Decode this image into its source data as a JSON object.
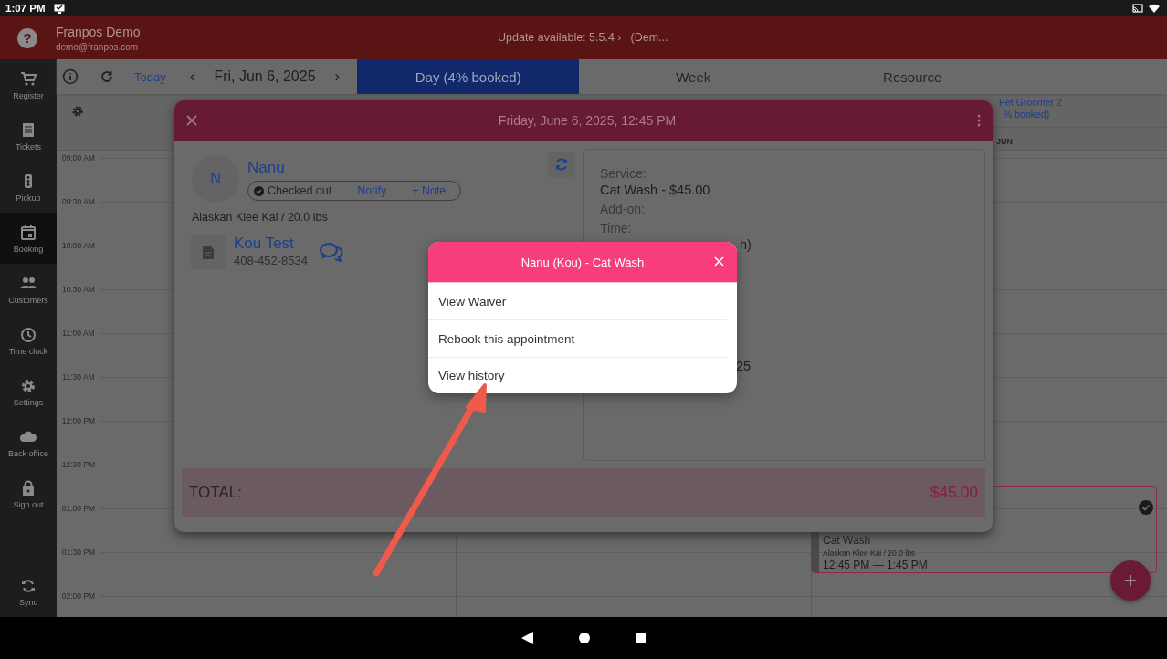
{
  "status_bar": {
    "time": "1:07 PM"
  },
  "header": {
    "help_icon": "?",
    "title": "Franpos Demo",
    "email": "demo@franpos.com",
    "update": "Update available: 5.5.4 ›",
    "update_note": "(Dem..."
  },
  "sidebar": {
    "items": [
      {
        "label": "Register",
        "selected": false
      },
      {
        "label": "Tickets",
        "selected": false
      },
      {
        "label": "Pickup",
        "selected": false
      },
      {
        "label": "Booking",
        "selected": true
      },
      {
        "label": "Customers",
        "selected": false
      },
      {
        "label": "Time clock",
        "selected": false
      },
      {
        "label": "Settings",
        "selected": false
      },
      {
        "label": "Back office",
        "selected": false
      },
      {
        "label": "Sign out",
        "selected": false
      }
    ],
    "sync": "Sync"
  },
  "toolbar": {
    "today": "Today",
    "prev": "‹",
    "date": "Fri, Jun 6, 2025",
    "next": "›",
    "tabs": [
      {
        "label": "Day (4% booked)",
        "selected": true
      },
      {
        "label": "Week",
        "selected": false
      },
      {
        "label": "Resource",
        "selected": false
      }
    ]
  },
  "calendar": {
    "resource": {
      "name": "Pet Groomer 2",
      "booked": "% booked)",
      "day": "JUN"
    },
    "times": [
      "09:00 AM",
      "09:30 AM",
      "10:00 AM",
      "10:30 AM",
      "11:00 AM",
      "11:30 AM",
      "12:00 PM",
      "12:30 PM",
      "01:00 PM",
      "01:30 PM",
      "02:00 PM"
    ],
    "appointment": {
      "service": "Cat Wash",
      "pet": "Alaskan Klee Kai / 20.0 lbs",
      "time": "12:45 PM — 1:45 PM"
    }
  },
  "modal": {
    "title": "Friday, June 6, 2025, 12:45 PM",
    "pet": {
      "initial": "N",
      "name": "Nanu",
      "status": "Checked out",
      "notify": "Notify",
      "note": "+ Note",
      "breed": "Alaskan Klee Kai / 20.0 lbs"
    },
    "owner": {
      "name": "Kou Test",
      "phone": "408-452-8534"
    },
    "details": [
      {
        "kind": "label",
        "text": "Service:"
      },
      {
        "kind": "value",
        "text": "Cat Wash - $45.00"
      },
      {
        "kind": "label",
        "text": "Add-on:"
      },
      {
        "kind": "label",
        "text": "Time:"
      },
      {
        "kind": "fragment",
        "text": "h)"
      },
      {
        "kind": "fragment",
        "text": "25"
      }
    ],
    "total_label": "TOTAL:",
    "total": "$45.00"
  },
  "popup": {
    "title": "Nanu (Kou) - Cat Wash",
    "items": [
      "View Waiver",
      "Rebook this appointment",
      "View history"
    ]
  }
}
